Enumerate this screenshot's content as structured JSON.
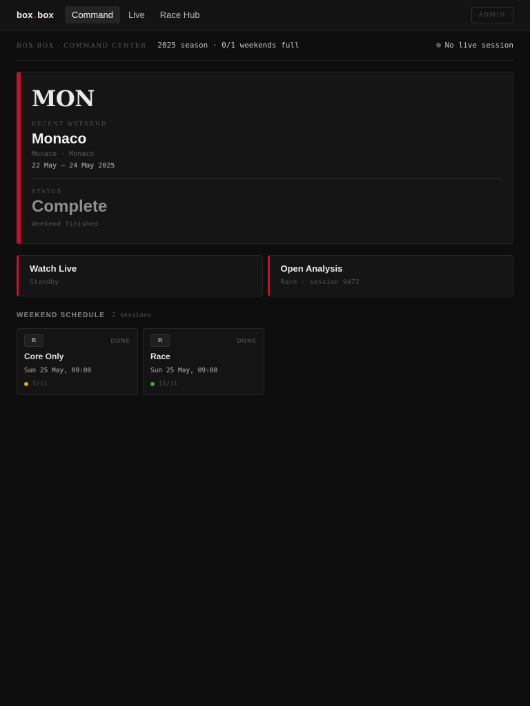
{
  "nav": {
    "brand_left": "box",
    "brand_sep": "-",
    "brand_right": "box",
    "tabs": [
      {
        "label": "Command",
        "active": true
      },
      {
        "label": "Live",
        "active": false
      },
      {
        "label": "Race Hub",
        "active": false
      }
    ],
    "admin_label": "ADMIN"
  },
  "subhead": {
    "crumb": "BOX-BOX · COMMAND CENTER",
    "season": "2025 season · 0/1 weekends full",
    "live_status": "No live session"
  },
  "hero": {
    "code": "MON",
    "recent_label": "RECENT WEEKEND",
    "name": "Monaco",
    "location": "Monaco · Monaco",
    "dates": "22 May — 24 May 2025",
    "status_label": "STATUS",
    "status": "Complete",
    "status_sub": "Weekend finished"
  },
  "actions": [
    {
      "title": "Watch Live",
      "subtitle": "Standby"
    },
    {
      "title": "Open Analysis",
      "subtitle": "Race · session 9472"
    }
  ],
  "schedule": {
    "title": "WEEKEND SCHEDULE",
    "count": "2 sessions",
    "sessions": [
      {
        "badge": "R",
        "state": "DONE",
        "name": "Core Only",
        "when": "Sun 25 May, 09:00",
        "progress": "5/11",
        "dot_color": "#d4b106"
      },
      {
        "badge": "R",
        "state": "DONE",
        "name": "Race",
        "when": "Sun 25 May, 09:00",
        "progress": "11/11",
        "dot_color": "#3fae3f"
      }
    ]
  },
  "colors": {
    "accent": "#c8102e",
    "background": "#0e0e0e"
  }
}
